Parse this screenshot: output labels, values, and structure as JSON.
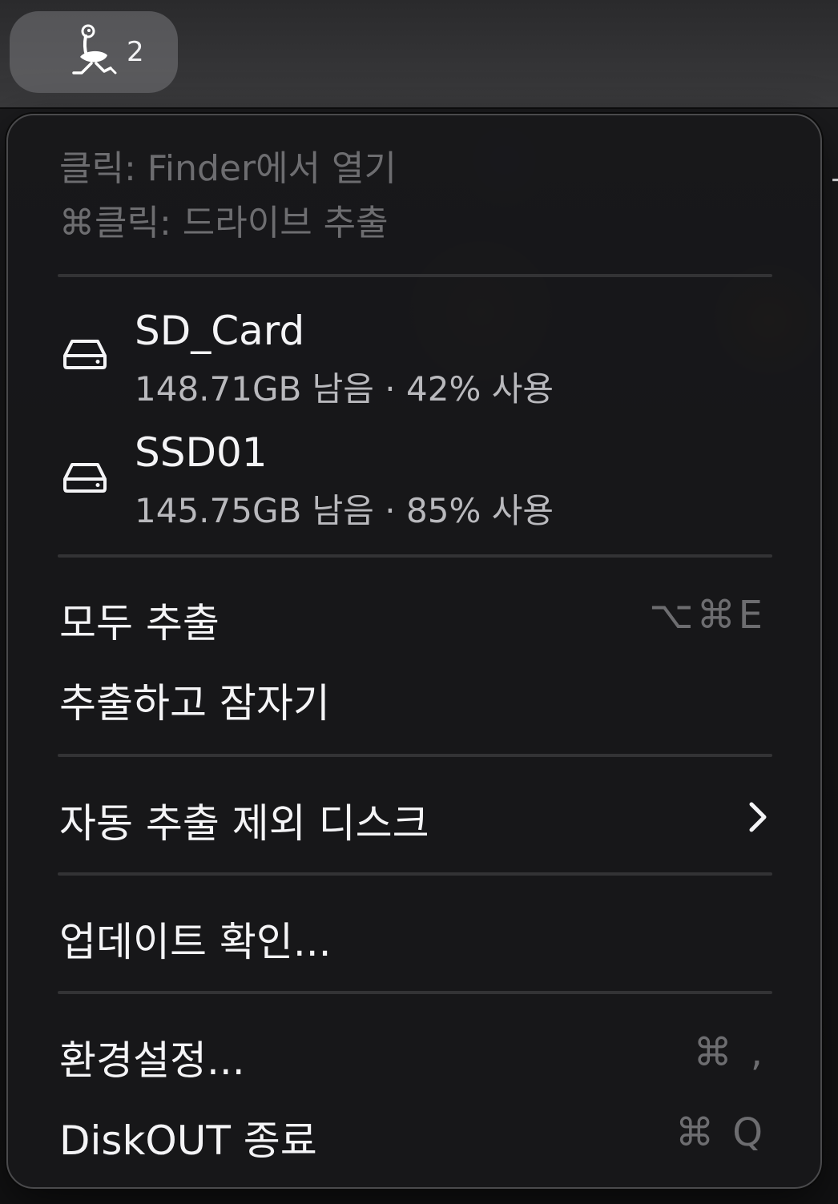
{
  "menubar": {
    "status_icon": "ostrich-icon",
    "badge_count": "2"
  },
  "menu": {
    "hints": {
      "click": "클릭: Finder에서 열기",
      "cmd_click": "⌘클릭: 드라이브 추출"
    },
    "drives": [
      {
        "icon": "drive-icon",
        "name": "SD_Card",
        "detail": "148.71GB 남음 · 42% 사용"
      },
      {
        "icon": "drive-icon",
        "name": "SSD01",
        "detail": "145.75GB 남음 · 85% 사용"
      }
    ],
    "eject_all": {
      "label": "모두 추출",
      "shortcut": "⌥⌘E"
    },
    "eject_sleep": {
      "label": "추출하고 잠자기"
    },
    "exclude_disks": {
      "label": "자동 추출 제외 디스크",
      "icon": "chevron-right-icon"
    },
    "check_updates": {
      "label": "업데이트 확인..."
    },
    "preferences": {
      "label": "환경설정...",
      "shortcut": "⌘ ,"
    },
    "quit": {
      "label": "DiskOUT 종료",
      "shortcut": "⌘ Q"
    }
  }
}
